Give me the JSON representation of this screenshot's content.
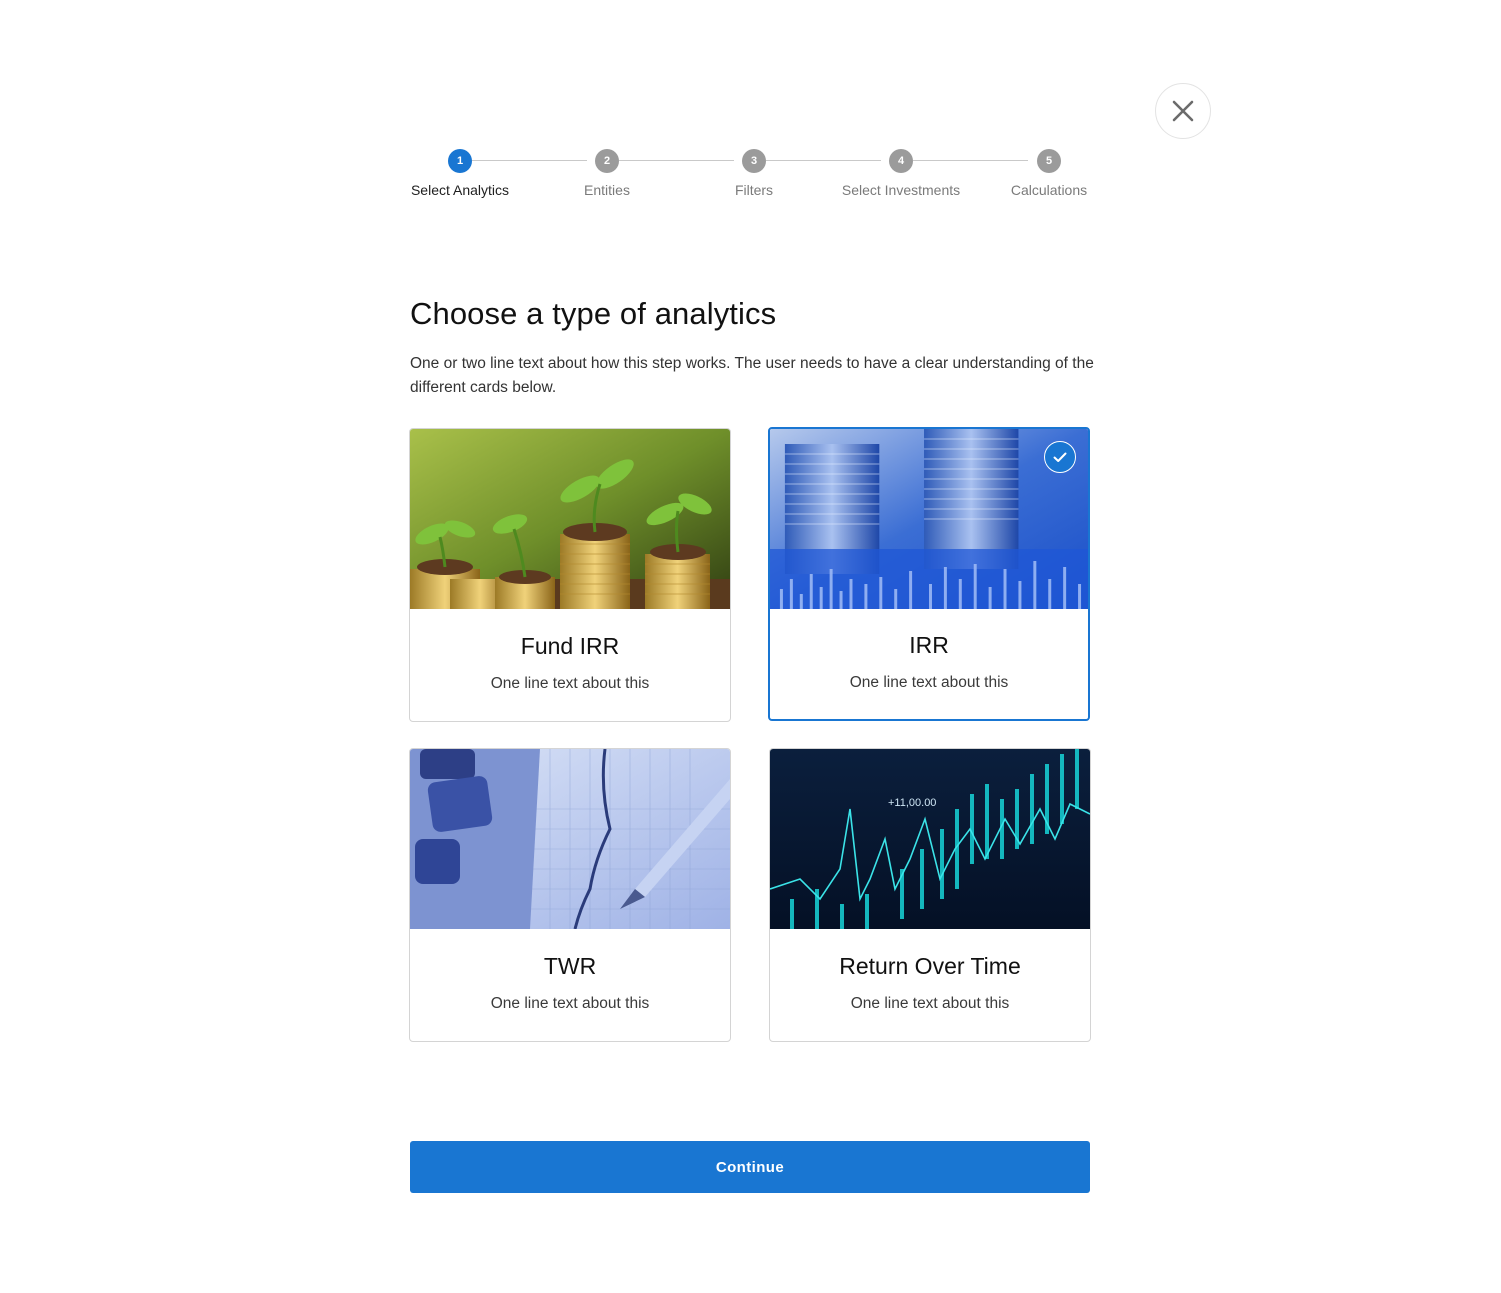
{
  "close": {
    "icon": "close-icon"
  },
  "stepper": {
    "steps": [
      {
        "number": "1",
        "label": "Select Analytics",
        "active": true
      },
      {
        "number": "2",
        "label": "Entities",
        "active": false
      },
      {
        "number": "3",
        "label": "Filters",
        "active": false
      },
      {
        "number": "4",
        "label": "Select Investments",
        "active": false
      },
      {
        "number": "5",
        "label": "Calculations",
        "active": false
      }
    ]
  },
  "main": {
    "title": "Choose a type of analytics",
    "description": "One or two line text about how this step works. The user needs to have a clear understanding of the different cards below."
  },
  "cards": [
    {
      "title": "Fund IRR",
      "subtitle": "One line text about this",
      "selected": false,
      "image": "plants-on-coins-image"
    },
    {
      "title": "IRR",
      "subtitle": "One line text about this",
      "selected": true,
      "image": "blue-coin-stacks-image"
    },
    {
      "title": "TWR",
      "subtitle": "One line text about this",
      "selected": false,
      "image": "calculator-pen-chart-image"
    },
    {
      "title": "Return Over Time",
      "subtitle": "One line text about this",
      "selected": false,
      "image": "stock-market-chart-image",
      "image_text": "+11,00.00"
    }
  ],
  "footer": {
    "continue_label": "Continue"
  },
  "colors": {
    "accent": "#1976d2",
    "inactive_step": "#9b9b9b",
    "border": "#d4d4d4"
  }
}
